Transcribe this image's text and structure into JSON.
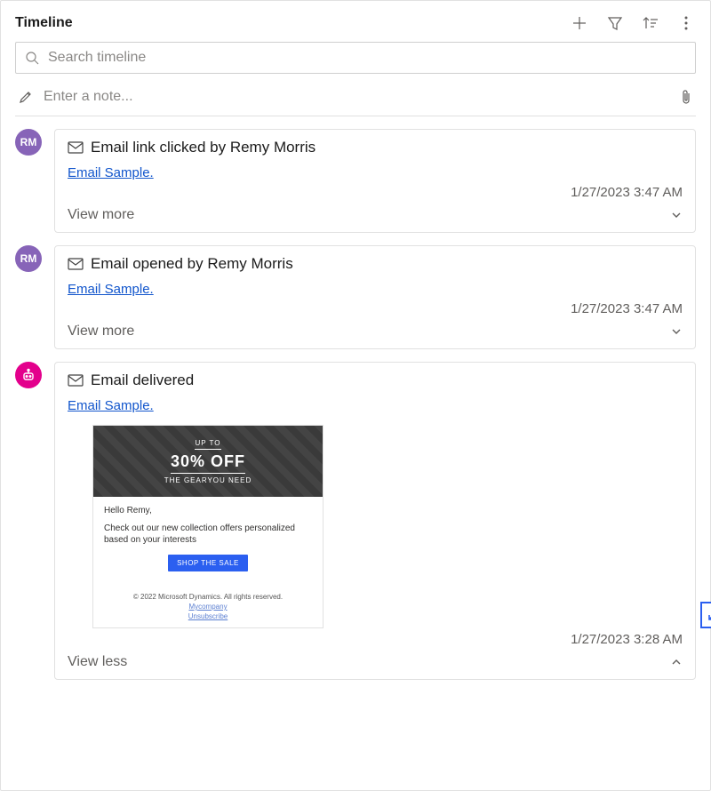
{
  "header": {
    "title": "Timeline",
    "search_placeholder": "Search timeline",
    "note_placeholder": "Enter a note..."
  },
  "items": [
    {
      "avatar_text": "RM",
      "avatar_type": "user",
      "title": "Email link clicked by Remy Morris",
      "link": "Email Sample.",
      "timestamp": "1/27/2023 3:47 AM",
      "toggle_label": "View more",
      "expanded": false
    },
    {
      "avatar_text": "RM",
      "avatar_type": "user",
      "title": "Email opened by Remy Morris",
      "link": "Email Sample.",
      "timestamp": "1/27/2023 3:47 AM",
      "toggle_label": "View more",
      "expanded": false
    },
    {
      "avatar_text": "",
      "avatar_type": "bot",
      "title": "Email delivered",
      "link": "Email Sample.",
      "timestamp": "1/27/2023 3:28 AM",
      "toggle_label": "View less",
      "expanded": true
    }
  ],
  "preview": {
    "upto": "UP TO",
    "off": "30% OFF",
    "gear": "THE GEARYOU NEED",
    "greeting": "Hello Remy,",
    "body": "Check out our new collection offers personalized based on your interests",
    "cta": "SHOP THE SALE",
    "copyright": "© 2022 Microsoft Dynamics. All rights reserved.",
    "company_link": "Mycompany",
    "unsubscribe_link": "Unsubscribe"
  }
}
